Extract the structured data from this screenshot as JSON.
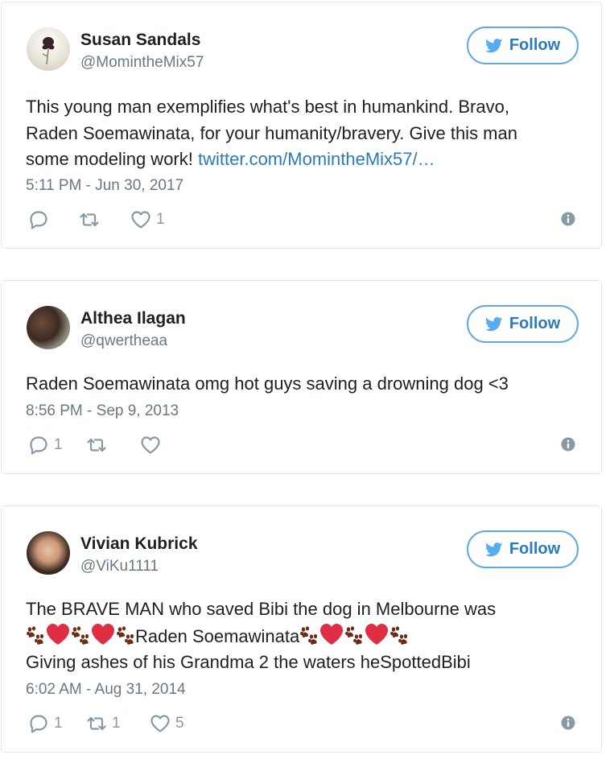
{
  "tweets": [
    {
      "name": "Susan Sandals",
      "handle": "@MomintheMix57",
      "follow_label": "Follow",
      "text_line1": "This young man exemplifies what's best in humankind. Bravo,",
      "text_line2": "Raden Soemawinata, for your humanity/bravery. Give this man",
      "text_line3": "some modeling work!",
      "link": "twitter.com/MomintheMix57/…",
      "timestamp": "5:11 PM - Jun 30, 2017",
      "replies": "",
      "retweets": "",
      "likes": "1"
    },
    {
      "name": "Althea Ilagan",
      "handle": "@qwertheaa",
      "follow_label": "Follow",
      "text_line1": "Raden Soemawinata omg hot guys saving a drowning dog <3",
      "timestamp": "8:56 PM - Sep 9, 2013",
      "replies": "1",
      "retweets": "",
      "likes": ""
    },
    {
      "name": "Vivian Kubrick",
      "handle": "@ViKu1111",
      "follow_label": "Follow",
      "text_line1": "The BRAVE MAN who saved Bibi the dog in Melbourne was",
      "text_line2_name": "Raden Soemawinata",
      "text_line3": "Giving ashes of his Grandma 2 the waters heSpottedBibi",
      "timestamp": "6:02 AM - Aug 31, 2014",
      "replies": "1",
      "retweets": "1",
      "likes": "5"
    }
  ],
  "icons": {
    "twitter_bird": "twitter-bird-icon",
    "reply": "reply-icon",
    "retweet": "retweet-icon",
    "like": "heart-icon",
    "info": "info-icon",
    "paw_emoji": "paw-prints-emoji",
    "heart_emoji": "red-heart-emoji"
  },
  "colors": {
    "link": "#2b7bb9",
    "follow_border": "#5ea9dd",
    "muted": "#697882",
    "heart_emoji": "#dd2e44",
    "paw_emoji": "#6d2a14"
  }
}
